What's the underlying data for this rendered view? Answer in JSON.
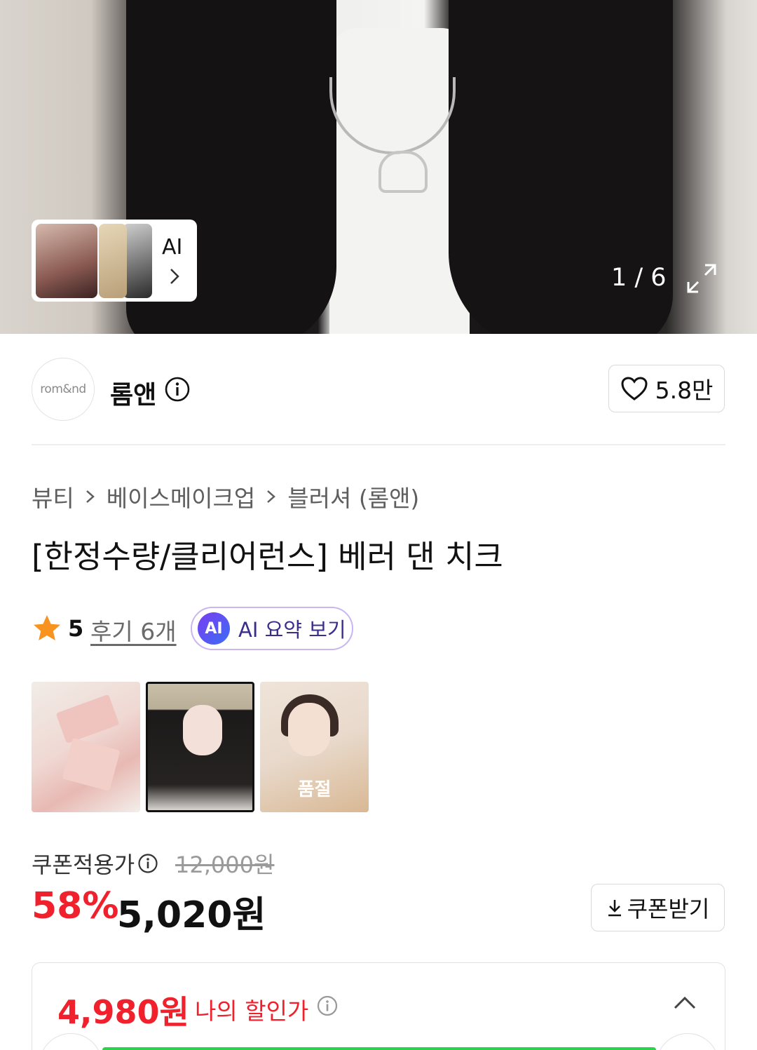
{
  "hero": {
    "ai_label": "AI",
    "pager": "1 / 6"
  },
  "brand": {
    "logo_text": "rom&nd",
    "name": "롬앤",
    "likes": "5.8만"
  },
  "breadcrumb": [
    "뷰티",
    "베이스메이크업",
    "블러셔 (롬앤)"
  ],
  "product": {
    "title": "[한정수량/클리어런스] 베러 댄 치크",
    "rating": "5",
    "reviews": "후기 6개",
    "ai_summary": "AI 요약 보기",
    "ai_badge": "AI",
    "soldout_label": "품절"
  },
  "price": {
    "coupon_label": "쿠폰적용가",
    "original": "12,000원",
    "discount": "58%",
    "final": "5,020원",
    "coupon_button": "쿠폰받기"
  },
  "my_discount": {
    "price": "4,980원",
    "label": "나의 할인가"
  },
  "colors": {
    "accent_red": "#f0212c",
    "progress_green": "#2ad34b",
    "ai_purple": "#7a3cf0",
    "star": "#f7931e"
  }
}
